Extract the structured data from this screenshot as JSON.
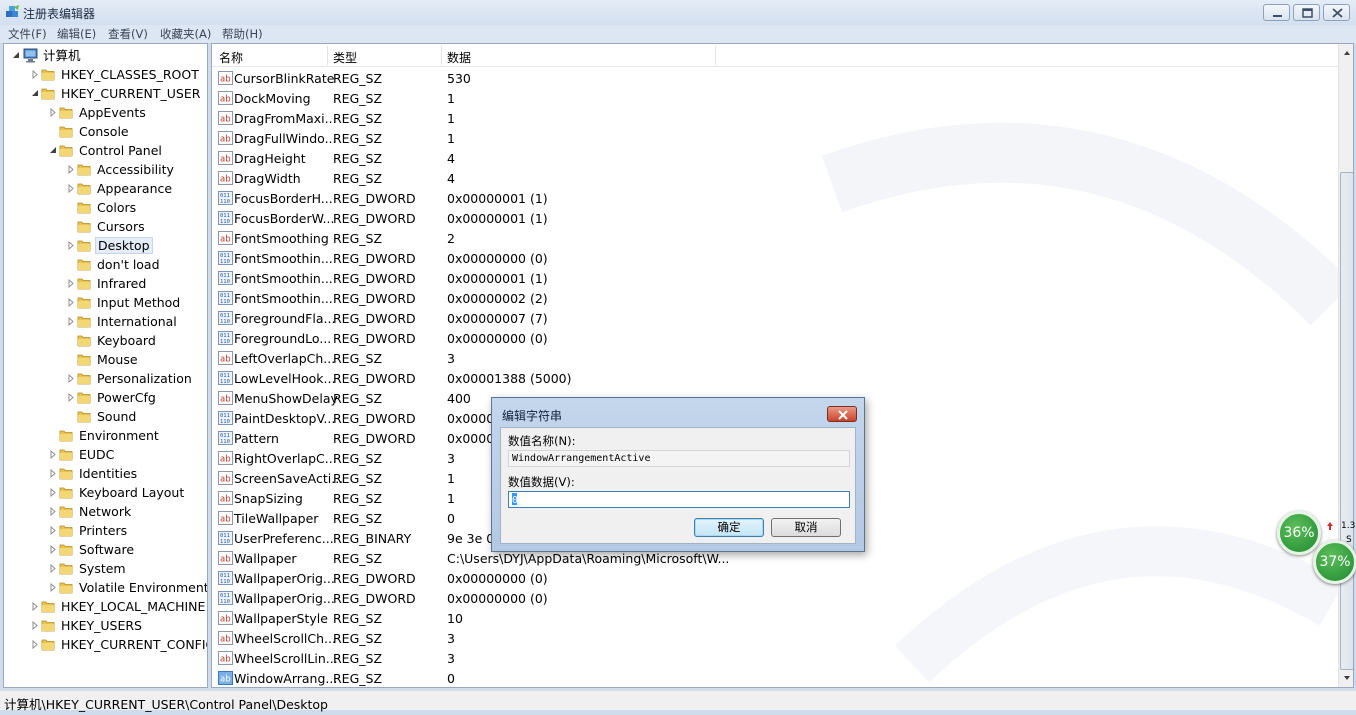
{
  "window": {
    "title": "注册表编辑器",
    "controls": [
      "minimize-icon",
      "maximize-icon",
      "close-icon"
    ]
  },
  "menu": [
    "文件(F)",
    "编辑(E)",
    "查看(V)",
    "收藏夹(A)",
    "帮助(H)"
  ],
  "tree": {
    "root": "计算机",
    "items": [
      {
        "label": "HKEY_CLASSES_ROOT",
        "level": 1,
        "expander": "collapsed"
      },
      {
        "label": "HKEY_CURRENT_USER",
        "level": 1,
        "expander": "expanded"
      },
      {
        "label": "AppEvents",
        "level": 2,
        "expander": "collapsed"
      },
      {
        "label": "Console",
        "level": 2,
        "expander": "none"
      },
      {
        "label": "Control Panel",
        "level": 2,
        "expander": "expanded"
      },
      {
        "label": "Accessibility",
        "level": 3,
        "expander": "collapsed"
      },
      {
        "label": "Appearance",
        "level": 3,
        "expander": "collapsed"
      },
      {
        "label": "Colors",
        "level": 3,
        "expander": "none"
      },
      {
        "label": "Cursors",
        "level": 3,
        "expander": "none"
      },
      {
        "label": "Desktop",
        "level": 3,
        "expander": "collapsed",
        "selected": true
      },
      {
        "label": "don't load",
        "level": 3,
        "expander": "none"
      },
      {
        "label": "Infrared",
        "level": 3,
        "expander": "collapsed"
      },
      {
        "label": "Input Method",
        "level": 3,
        "expander": "collapsed"
      },
      {
        "label": "International",
        "level": 3,
        "expander": "collapsed"
      },
      {
        "label": "Keyboard",
        "level": 3,
        "expander": "none"
      },
      {
        "label": "Mouse",
        "level": 3,
        "expander": "none"
      },
      {
        "label": "Personalization",
        "level": 3,
        "expander": "collapsed"
      },
      {
        "label": "PowerCfg",
        "level": 3,
        "expander": "collapsed"
      },
      {
        "label": "Sound",
        "level": 3,
        "expander": "none"
      },
      {
        "label": "Environment",
        "level": 2,
        "expander": "none"
      },
      {
        "label": "EUDC",
        "level": 2,
        "expander": "collapsed"
      },
      {
        "label": "Identities",
        "level": 2,
        "expander": "collapsed"
      },
      {
        "label": "Keyboard Layout",
        "level": 2,
        "expander": "collapsed"
      },
      {
        "label": "Network",
        "level": 2,
        "expander": "collapsed"
      },
      {
        "label": "Printers",
        "level": 2,
        "expander": "collapsed"
      },
      {
        "label": "Software",
        "level": 2,
        "expander": "collapsed"
      },
      {
        "label": "System",
        "level": 2,
        "expander": "collapsed"
      },
      {
        "label": "Volatile Environment",
        "level": 2,
        "expander": "collapsed"
      },
      {
        "label": "HKEY_LOCAL_MACHINE",
        "level": 1,
        "expander": "collapsed"
      },
      {
        "label": "HKEY_USERS",
        "level": 1,
        "expander": "collapsed"
      },
      {
        "label": "HKEY_CURRENT_CONFIG",
        "level": 1,
        "expander": "collapsed"
      }
    ]
  },
  "list": {
    "columns": [
      "名称",
      "类型",
      "数据"
    ],
    "rows": [
      {
        "icon": "string",
        "name": "CursorBlinkRate",
        "type": "REG_SZ",
        "data": "530"
      },
      {
        "icon": "string",
        "name": "DockMoving",
        "type": "REG_SZ",
        "data": "1"
      },
      {
        "icon": "string",
        "name": "DragFromMaxi...",
        "type": "REG_SZ",
        "data": "1"
      },
      {
        "icon": "string",
        "name": "DragFullWindo...",
        "type": "REG_SZ",
        "data": "1"
      },
      {
        "icon": "string",
        "name": "DragHeight",
        "type": "REG_SZ",
        "data": "4"
      },
      {
        "icon": "string",
        "name": "DragWidth",
        "type": "REG_SZ",
        "data": "4"
      },
      {
        "icon": "binary",
        "name": "FocusBorderH...",
        "type": "REG_DWORD",
        "data": "0x00000001 (1)"
      },
      {
        "icon": "binary",
        "name": "FocusBorderW...",
        "type": "REG_DWORD",
        "data": "0x00000001 (1)"
      },
      {
        "icon": "string",
        "name": "FontSmoothing",
        "type": "REG_SZ",
        "data": "2"
      },
      {
        "icon": "binary",
        "name": "FontSmoothin...",
        "type": "REG_DWORD",
        "data": "0x00000000 (0)"
      },
      {
        "icon": "binary",
        "name": "FontSmoothin...",
        "type": "REG_DWORD",
        "data": "0x00000001 (1)"
      },
      {
        "icon": "binary",
        "name": "FontSmoothin...",
        "type": "REG_DWORD",
        "data": "0x00000002 (2)"
      },
      {
        "icon": "binary",
        "name": "ForegroundFla...",
        "type": "REG_DWORD",
        "data": "0x00000007 (7)"
      },
      {
        "icon": "binary",
        "name": "ForegroundLo...",
        "type": "REG_DWORD",
        "data": "0x00000000 (0)"
      },
      {
        "icon": "string",
        "name": "LeftOverlapCh...",
        "type": "REG_SZ",
        "data": "3"
      },
      {
        "icon": "binary",
        "name": "LowLevelHook...",
        "type": "REG_DWORD",
        "data": "0x00001388 (5000)"
      },
      {
        "icon": "string",
        "name": "MenuShowDelay",
        "type": "REG_SZ",
        "data": "400"
      },
      {
        "icon": "binary",
        "name": "PaintDesktopV...",
        "type": "REG_DWORD",
        "data": "0x000000"
      },
      {
        "icon": "binary",
        "name": "Pattern",
        "type": "REG_DWORD",
        "data": "0x000000"
      },
      {
        "icon": "string",
        "name": "RightOverlapC...",
        "type": "REG_SZ",
        "data": "3"
      },
      {
        "icon": "string",
        "name": "ScreenSaveActi...",
        "type": "REG_SZ",
        "data": "1"
      },
      {
        "icon": "string",
        "name": "SnapSizing",
        "type": "REG_SZ",
        "data": "1"
      },
      {
        "icon": "string",
        "name": "TileWallpaper",
        "type": "REG_SZ",
        "data": "0"
      },
      {
        "icon": "binary",
        "name": "UserPreferenc...",
        "type": "REG_BINARY",
        "data": "9e 3e 07"
      },
      {
        "icon": "string",
        "name": "Wallpaper",
        "type": "REG_SZ",
        "data": "C:\\Users\\DYJ\\AppData\\Roaming\\Microsoft\\W..."
      },
      {
        "icon": "binary",
        "name": "WallpaperOrig...",
        "type": "REG_DWORD",
        "data": "0x00000000 (0)"
      },
      {
        "icon": "binary",
        "name": "WallpaperOrig...",
        "type": "REG_DWORD",
        "data": "0x00000000 (0)"
      },
      {
        "icon": "string",
        "name": "WallpaperStyle",
        "type": "REG_SZ",
        "data": "10"
      },
      {
        "icon": "string",
        "name": "WheelScrollCh...",
        "type": "REG_SZ",
        "data": "3"
      },
      {
        "icon": "string",
        "name": "WheelScrollLin...",
        "type": "REG_SZ",
        "data": "3"
      },
      {
        "icon": "string-selected",
        "name": "WindowArrang...",
        "type": "REG_SZ",
        "data": "0"
      }
    ]
  },
  "status": {
    "path": "计算机\\HKEY_CURRENT_USER\\Control Panel\\Desktop"
  },
  "dialog": {
    "title": "编辑字符串",
    "name_label": "数值名称(N):",
    "name_value": "WindowArrangementActive",
    "data_label": "数值数据(V):",
    "data_value": "0",
    "ok_label": "确定",
    "cancel_label": "取消"
  },
  "overlay": {
    "gauge_top": "36%",
    "gauge_bottom": "37%",
    "snippet_1": "1.3",
    "snippet_2": "S"
  },
  "colors": {
    "folder": "#e8c44f",
    "string_icon": "#c0392b",
    "binary_icon": "#2b5aa8",
    "gauge_green": "#2e9b3d",
    "dialog_accent": "#3c7fb1"
  }
}
